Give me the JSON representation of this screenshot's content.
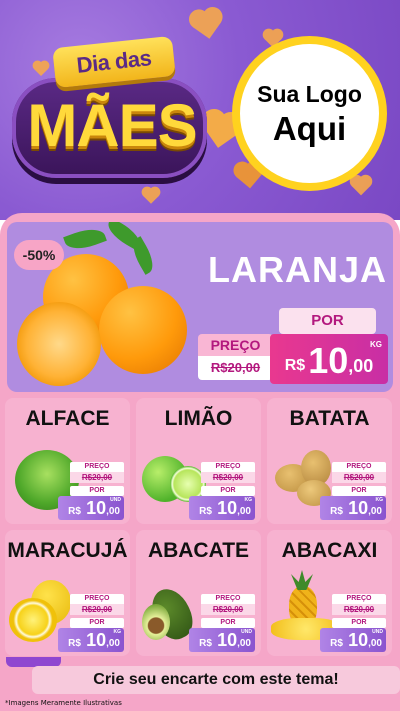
{
  "header": {
    "title_top": "Dia das",
    "title_main": "MÃES",
    "logo_line1": "Sua Logo",
    "logo_line2": "Aqui"
  },
  "hero": {
    "discount": "-50%",
    "product": "LARANJA",
    "preco_label": "PREÇO",
    "old_price": "R$20,00",
    "por_label": "POR",
    "currency": "R$",
    "price_int": "10",
    "price_dec": ",00",
    "unit": "KG"
  },
  "products": [
    {
      "name": "ALFACE",
      "preco_label": "PREÇO",
      "old_price": "R$20,00",
      "por_label": "POR",
      "currency": "R$",
      "price_int": "10",
      "price_dec": ",00",
      "unit": "UND"
    },
    {
      "name": "LIMÃO",
      "preco_label": "PREÇO",
      "old_price": "R$20,00",
      "por_label": "POR",
      "currency": "R$",
      "price_int": "10",
      "price_dec": ",00",
      "unit": "KG"
    },
    {
      "name": "BATATA",
      "preco_label": "PREÇO",
      "old_price": "R$20,00",
      "por_label": "POR",
      "currency": "R$",
      "price_int": "10",
      "price_dec": ",00",
      "unit": "KG"
    },
    {
      "name": "MARACUJÁ",
      "preco_label": "PREÇO",
      "old_price": "R$20,00",
      "por_label": "POR",
      "currency": "R$",
      "price_int": "10",
      "price_dec": ",00",
      "unit": "KG"
    },
    {
      "name": "ABACATE",
      "preco_label": "PREÇO",
      "old_price": "R$20,00",
      "por_label": "POR",
      "currency": "R$",
      "price_int": "10",
      "price_dec": ",00",
      "unit": "UND"
    },
    {
      "name": "ABACAXI",
      "preco_label": "PREÇO",
      "old_price": "R$20,00",
      "por_label": "POR",
      "currency": "R$",
      "price_int": "10",
      "price_dec": ",00",
      "unit": "UND"
    }
  ],
  "footer": {
    "cta": "Crie seu encarte com este tema!",
    "disclaimer": "*Imagens Meramente Ilustrativas"
  },
  "colors": {
    "header_purple": "#8a5ad2",
    "panel_pink": "#f5a6c8",
    "hero_lilac": "#b08ce0",
    "price_magenta": "#e9388f",
    "mini_price_purple": "#8a54cf",
    "logo_ring": "#ffd21f"
  }
}
